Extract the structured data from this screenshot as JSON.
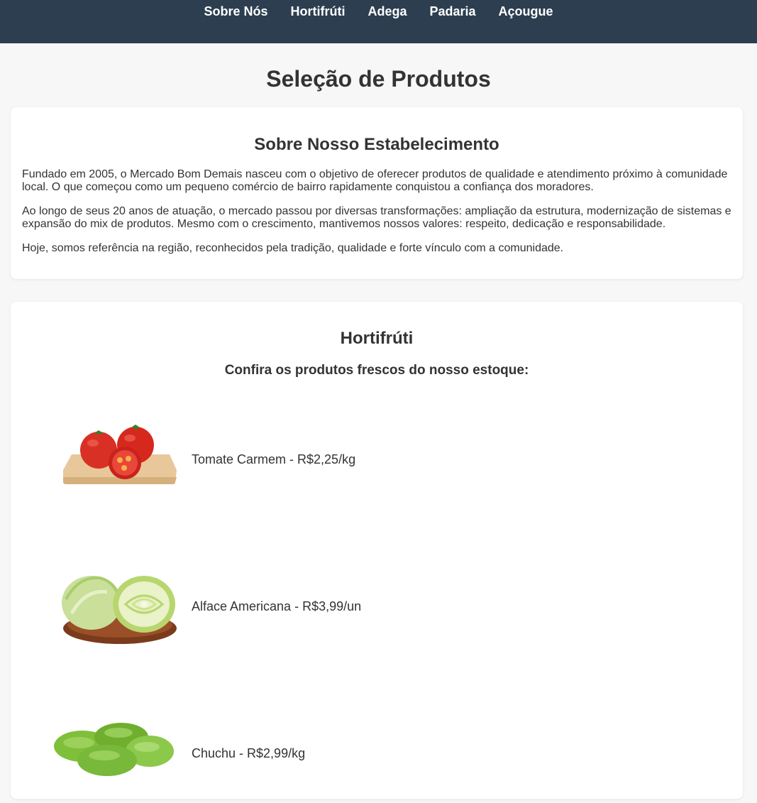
{
  "nav": {
    "items": [
      "Sobre Nós",
      "Hortifrúti",
      "Adega",
      "Padaria",
      "Açougue"
    ]
  },
  "page_title": "Seleção de Produtos",
  "about": {
    "heading": "Sobre Nosso Estabelecimento",
    "paragraphs": [
      "Fundado em 2005, o Mercado Bom Demais nasceu com o objetivo de oferecer produtos de qualidade e atendimento próximo à comunidade local. O que começou como um pequeno comércio de bairro rapidamente conquistou a confiança dos moradores.",
      "Ao longo de seus 20 anos de atuação, o mercado passou por diversas transformações: ampliação da estrutura, modernização de sistemas e expansão do mix de produtos. Mesmo com o crescimento, mantivemos nossos valores: respeito, dedicação e responsabilidade.",
      "Hoje, somos referência na região, reconhecidos pela tradição, qualidade e forte vínculo com a comunidade."
    ]
  },
  "produce": {
    "heading": "Hortifrúti",
    "subheading": "Confira os produtos frescos do nosso estoque:",
    "products": [
      {
        "label": "Tomate Carmem - R$2,25/kg",
        "image": "tomato-image"
      },
      {
        "label": "Alface Americana - R$3,99/un",
        "image": "lettuce-image"
      },
      {
        "label": "Chuchu - R$2,99/kg",
        "image": "chayote-image"
      }
    ]
  },
  "colors": {
    "nav_bg": "#2c3e50",
    "page_bg": "#f7f7f7",
    "card_bg": "#ffffff",
    "text": "#333333"
  }
}
